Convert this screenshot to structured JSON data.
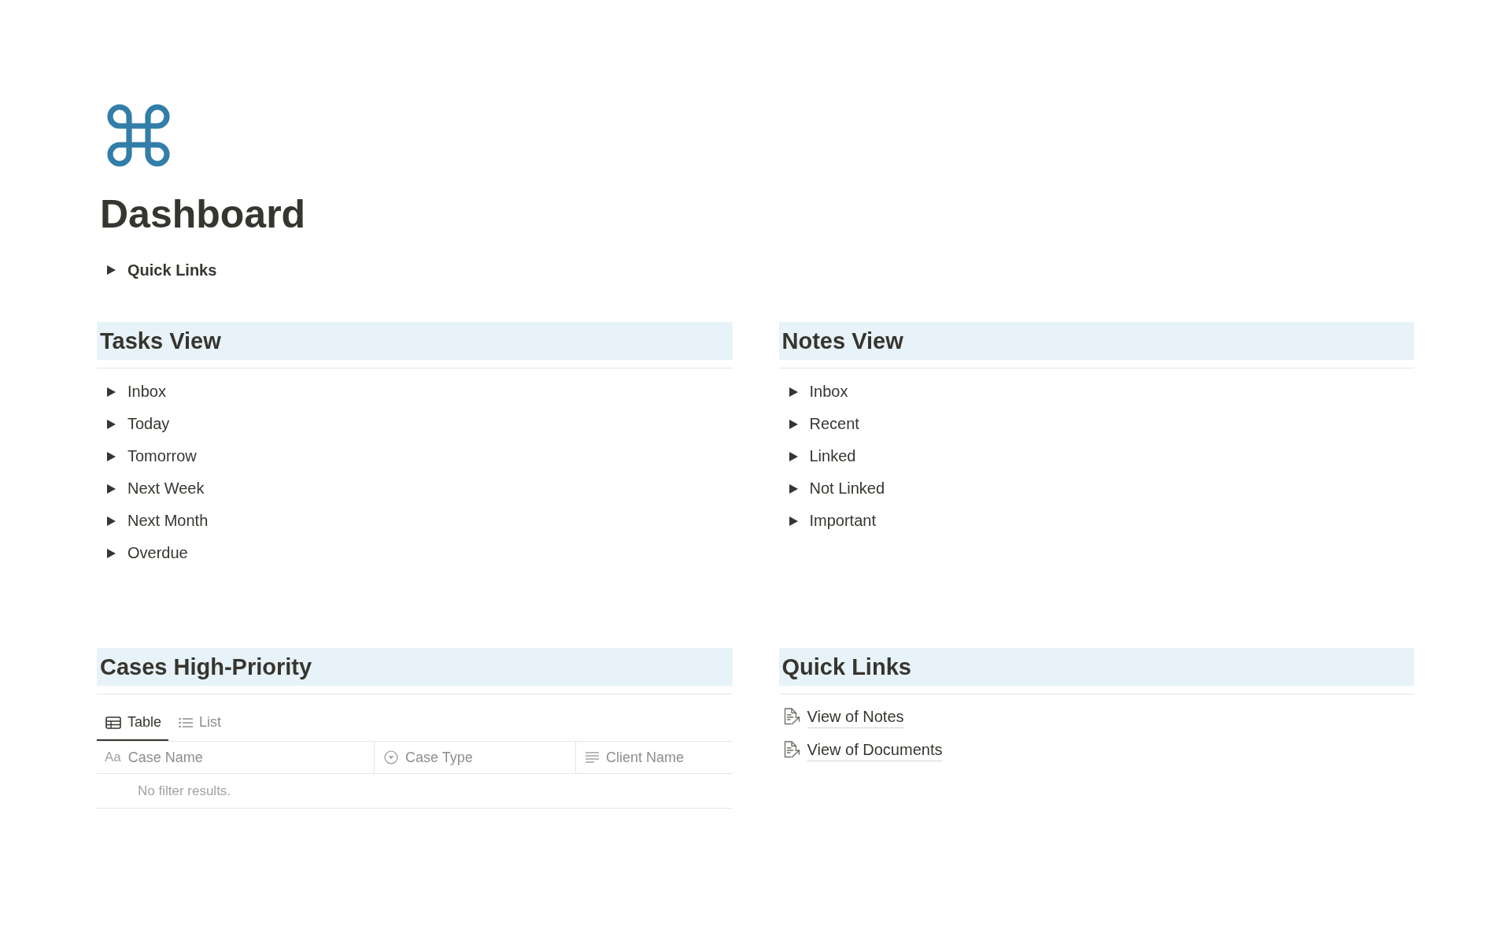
{
  "page": {
    "title": "Dashboard"
  },
  "top_toggle": {
    "label": "Quick Links",
    "expanded": false
  },
  "sections": [
    {
      "kind": "toggles",
      "heading": "Tasks View",
      "items": [
        {
          "label": "Inbox",
          "expanded": false
        },
        {
          "label": "Today",
          "expanded": false
        },
        {
          "label": "Tomorrow",
          "expanded": false
        },
        {
          "label": "Next Week",
          "expanded": false
        },
        {
          "label": "Next Month",
          "expanded": false
        },
        {
          "label": "Overdue",
          "expanded": false
        }
      ]
    },
    {
      "kind": "toggles",
      "heading": "Notes View",
      "items": [
        {
          "label": "Inbox",
          "expanded": false
        },
        {
          "label": "Recent",
          "expanded": false
        },
        {
          "label": "Linked",
          "expanded": false
        },
        {
          "label": "Not Linked",
          "expanded": false
        },
        {
          "label": "Important",
          "expanded": false
        }
      ]
    },
    {
      "kind": "database",
      "heading": "Cases High-Priority",
      "views": [
        {
          "label": "Table",
          "kind": "table",
          "selected": true
        },
        {
          "label": "List",
          "kind": "list",
          "selected": false
        }
      ],
      "columns": [
        {
          "label": "Case Name",
          "kind": "title",
          "glyph": "Aa"
        },
        {
          "label": "Case Type",
          "kind": "select"
        },
        {
          "label": "Client Name",
          "kind": "text"
        }
      ],
      "empty_text": "No filter results."
    },
    {
      "kind": "links",
      "heading": "Quick Links",
      "links": [
        {
          "label": "View of Notes"
        },
        {
          "label": "View of Documents"
        }
      ]
    }
  ]
}
